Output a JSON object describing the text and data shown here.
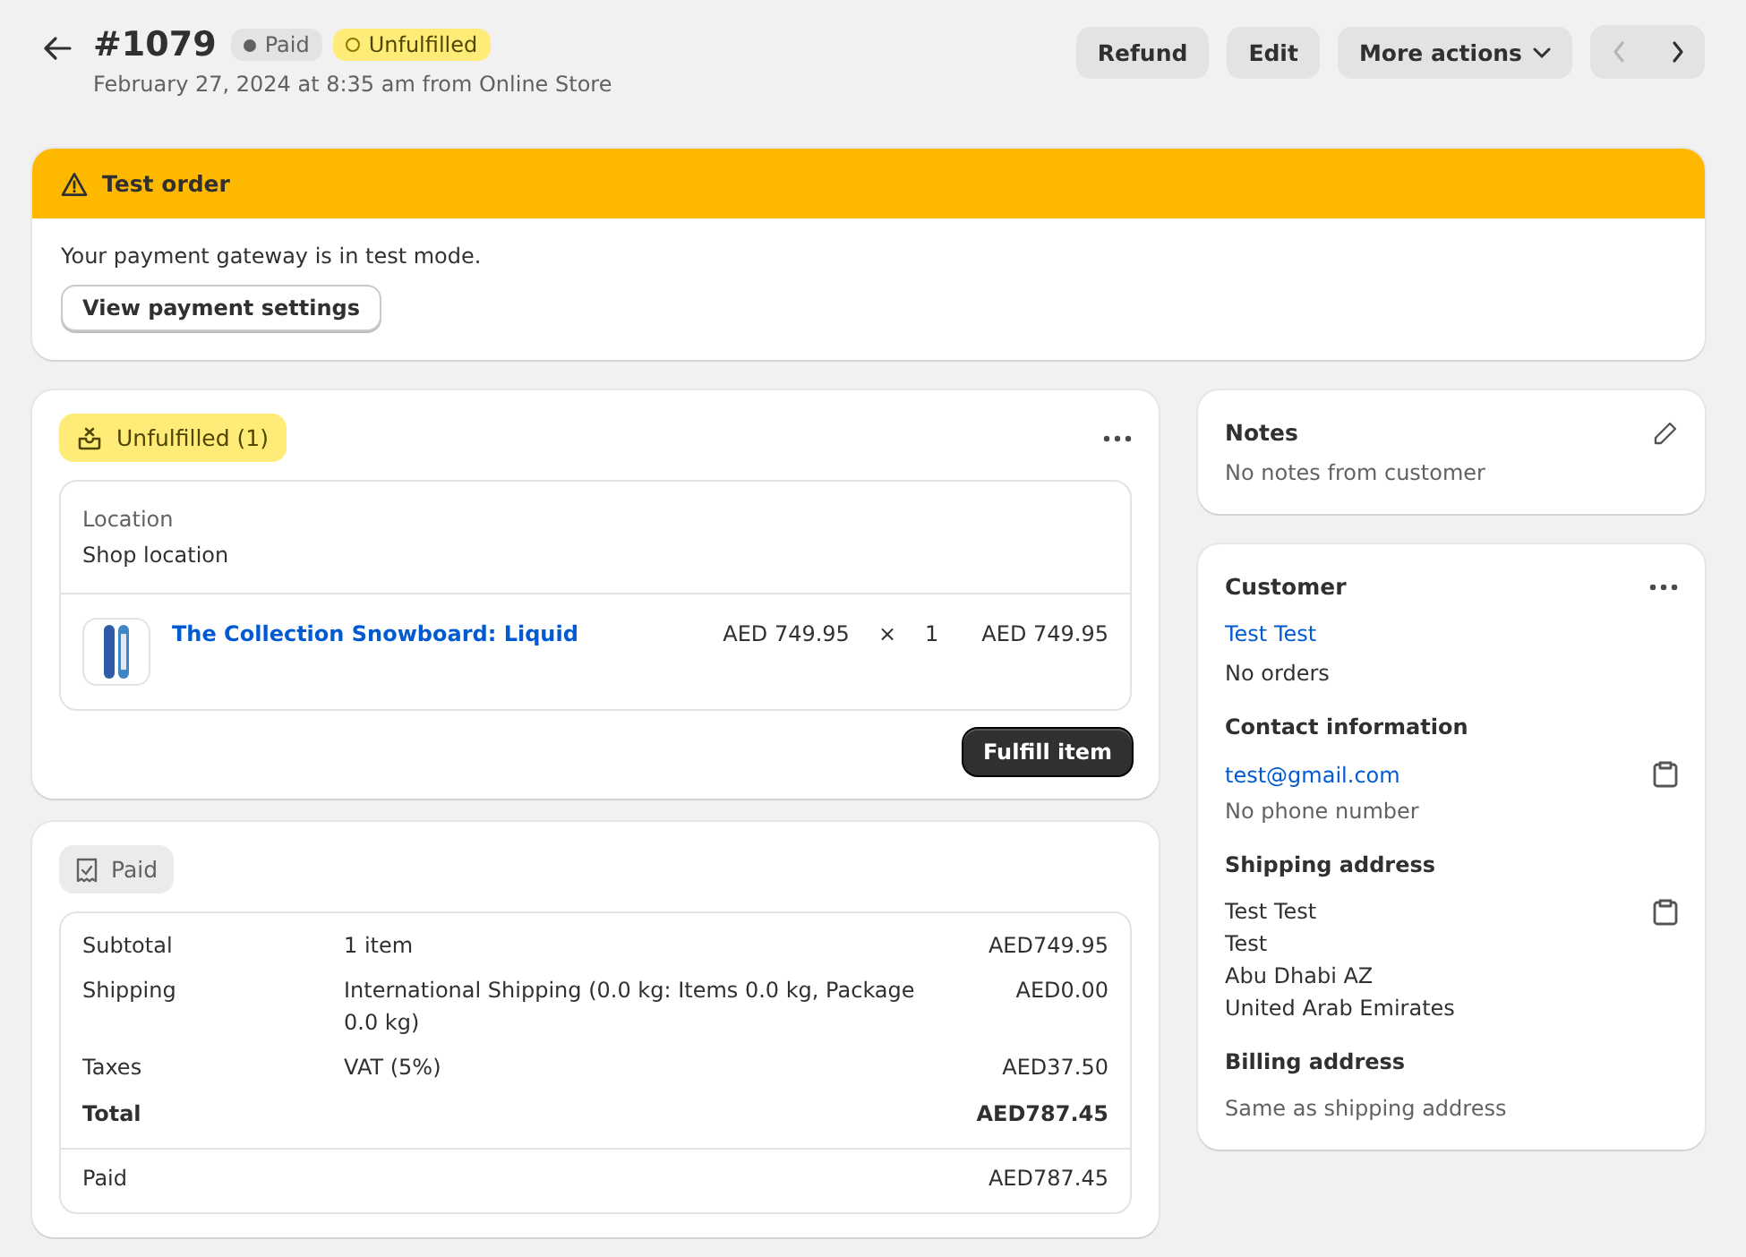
{
  "header": {
    "title": "#1079",
    "badges": [
      {
        "label": "Paid",
        "kind": "paid"
      },
      {
        "label": "Unfulfilled",
        "kind": "unfulfilled"
      }
    ],
    "subtitle": "February 27, 2024 at 8:35 am from Online Store",
    "actions": [
      "Refund",
      "Edit",
      "More actions"
    ],
    "pager": [
      {
        "kind": "prev",
        "disabled": true
      },
      {
        "kind": "next",
        "disabled": false
      }
    ]
  },
  "banner": {
    "title": "Test order",
    "message": "Your payment gateway is in test mode.",
    "button": "View payment settings"
  },
  "fulfillment": {
    "badge": "Unfulfilled (1)",
    "location_label": "Location",
    "location": "Shop location",
    "items": [
      {
        "name": "The Collection Snowboard: Liquid",
        "price": "AED 749.95",
        "times": "×",
        "quantity": "1",
        "total": "AED 749.95"
      }
    ],
    "button": "Fulfill item"
  },
  "payment": {
    "badge": "Paid",
    "rows": [
      {
        "label": "Subtotal",
        "detail": "1 item",
        "amount": "AED749.95",
        "kind": "line"
      },
      {
        "label": "Shipping",
        "detail": "International Shipping (0.0 kg: Items 0.0 kg, Package 0.0 kg)",
        "amount": "AED0.00",
        "kind": "line"
      },
      {
        "label": "Taxes",
        "detail": "VAT (5%)",
        "amount": "AED37.50",
        "kind": "line"
      },
      {
        "label": "Total",
        "amount": "AED787.45",
        "kind": "total"
      },
      {
        "label": "Paid",
        "amount": "AED787.45",
        "kind": "paid"
      }
    ]
  },
  "notes": {
    "title": "Notes",
    "text": "No notes from customer"
  },
  "customer": {
    "title": "Customer",
    "name": "Test Test",
    "orders": "No orders",
    "contact_title": "Contact information",
    "email": "test@gmail.com",
    "phone": "No phone number",
    "shipping_title": "Shipping address",
    "shipping_lines": [
      "Test Test",
      "Test",
      "Abu Dhabi AZ",
      "United Arab Emirates"
    ],
    "billing_title": "Billing address",
    "billing": "Same as shipping address"
  }
}
